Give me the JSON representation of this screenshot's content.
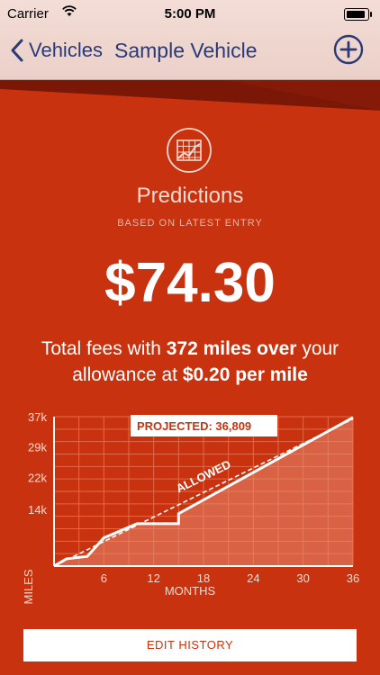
{
  "status_bar": {
    "carrier": "Carrier",
    "time": "5:00 PM"
  },
  "nav": {
    "back_label": "Vehicles",
    "title": "Sample Vehicle",
    "icons": {
      "back": "chevron-left-icon",
      "add": "plus-circle-icon"
    }
  },
  "colors": {
    "accent": "#c8320e",
    "nav_text": "#2b3a77",
    "nav_bg": "#f0d8d0"
  },
  "prediction": {
    "icon": "chart-grid-icon",
    "title": "Predictions",
    "subtitle": "BASED ON LATEST ENTRY",
    "amount": "$74.30",
    "desc_part1": "Total fees with ",
    "desc_bold1": "372 miles over",
    "desc_part2": " your allowance at ",
    "desc_bold2": "$0.20 per mile"
  },
  "chart_data": {
    "type": "line",
    "xlabel": "MONTHS",
    "ylabel": "MILES",
    "x_ticks": [
      "6",
      "12",
      "18",
      "24",
      "30",
      "36"
    ],
    "y_ticks": [
      "37k",
      "29k",
      "22k",
      "14k"
    ],
    "xlim": [
      0,
      36
    ],
    "ylim": [
      0,
      37000
    ],
    "projected_label": "PROJECTED: 36,809",
    "allowed_label": "ALLOWED",
    "series": [
      {
        "kind": "actual",
        "x": [
          0,
          1.5,
          4,
          6,
          10,
          15,
          15,
          36
        ],
        "y": [
          0,
          1800,
          2400,
          7000,
          10500,
          10500,
          13000,
          36809
        ]
      },
      {
        "kind": "allowed",
        "x": [
          0,
          36
        ],
        "y": [
          0,
          36436
        ]
      }
    ]
  },
  "actions": {
    "edit_history": "EDIT HISTORY"
  }
}
